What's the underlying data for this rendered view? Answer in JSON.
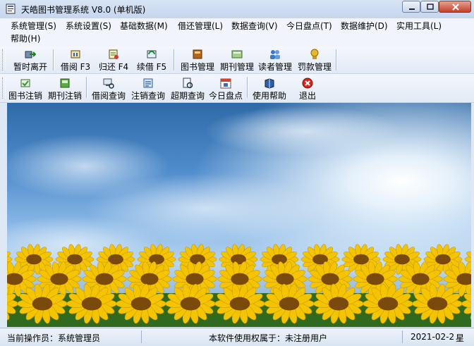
{
  "window": {
    "title": "天皓图书管理系统 V8.0 (单机版)"
  },
  "menu": {
    "items": [
      {
        "label": "系统管理(S)"
      },
      {
        "label": "系统设置(S)"
      },
      {
        "label": "基础数据(M)"
      },
      {
        "label": "借还管理(L)"
      },
      {
        "label": "数据查询(V)"
      },
      {
        "label": "今日盘点(T)"
      },
      {
        "label": "数据维护(D)"
      },
      {
        "label": "实用工具(L)"
      },
      {
        "label": "帮助(H)"
      }
    ]
  },
  "toolbar1": {
    "buttons": [
      {
        "label": "暂时离开",
        "icon": "leave-icon"
      },
      {
        "label": "借阅 F3",
        "icon": "borrow-icon"
      },
      {
        "label": "归还 F4",
        "icon": "return-icon"
      },
      {
        "label": "续借 F5",
        "icon": "renew-icon"
      },
      {
        "label": "图书管理",
        "icon": "book-icon"
      },
      {
        "label": "期刊管理",
        "icon": "journal-icon"
      },
      {
        "label": "读者管理",
        "icon": "readers-icon"
      },
      {
        "label": "罚款管理",
        "icon": "fine-icon"
      }
    ]
  },
  "toolbar2": {
    "buttons": [
      {
        "label": "图书注销",
        "icon": "book-cancel-icon"
      },
      {
        "label": "期刊注销",
        "icon": "journal-cancel-icon"
      },
      {
        "label": "借阅查询",
        "icon": "borrow-query-icon"
      },
      {
        "label": "注销查询",
        "icon": "cancel-query-icon"
      },
      {
        "label": "超期查询",
        "icon": "overdue-query-icon"
      },
      {
        "label": "今日盘点",
        "icon": "calendar-icon"
      },
      {
        "label": "使用帮助",
        "icon": "help-book-icon"
      },
      {
        "label": "退出",
        "icon": "exit-icon"
      }
    ]
  },
  "status": {
    "operator": "当前操作员：系统管理员",
    "license": "本软件使用权属于：未注册用户",
    "date": "2021-02-2",
    "extra": "星"
  },
  "colors": {
    "sky_top": "#2f6aa8",
    "sunflower": "#f5c400",
    "close_button": "#c4402b"
  }
}
